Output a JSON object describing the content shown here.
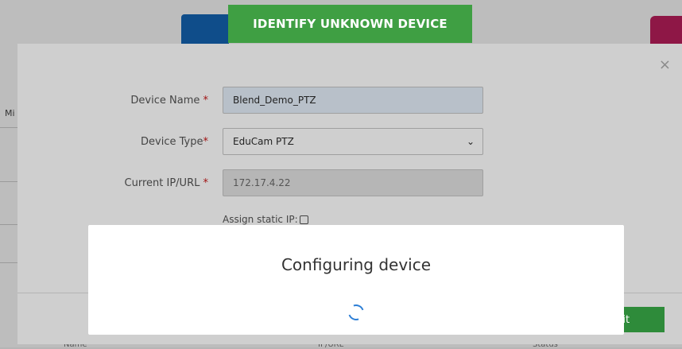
{
  "background": {
    "edge_text": "Mi",
    "bottom_texts": [
      "Name",
      "IP/URL",
      "Status"
    ]
  },
  "banner": {
    "title": "IDENTIFY UNKNOWN DEVICE"
  },
  "modal": {
    "close_label": "×",
    "fields": {
      "device_name": {
        "label": "Device Name",
        "required_mark": "*",
        "value": "Blend_Demo_PTZ"
      },
      "device_type": {
        "label": "Device Type",
        "required_mark": "*",
        "value": "EduCam PTZ",
        "chevron": "⌄"
      },
      "current_ip": {
        "label": "Current IP/URL",
        "required_mark": "*",
        "value": "172.17.4.22"
      },
      "static_ip": {
        "label": "Assign static IP:"
      }
    },
    "submit_label": "Submit",
    "submit_visible_label": "mit"
  },
  "dialog": {
    "title": "Configuring device"
  },
  "colors": {
    "banner_green": "#3f9f43",
    "submit_green": "#2e8b3a",
    "required_red": "#a11313",
    "spinner_blue": "#2d7fd6"
  }
}
